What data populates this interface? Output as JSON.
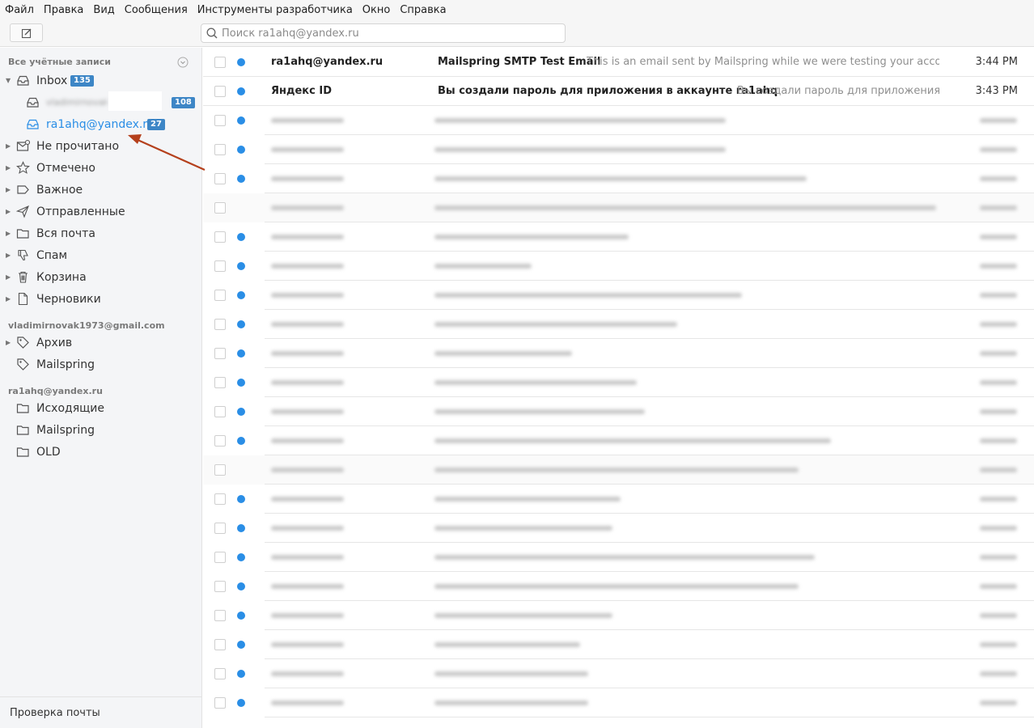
{
  "menubar": [
    "Файл",
    "Правка",
    "Вид",
    "Сообщения",
    "Инструменты разработчика",
    "Окно",
    "Справка"
  ],
  "search": {
    "placeholder": "Поиск ra1ahq@yandex.ru"
  },
  "sidebar": {
    "all_accounts_heading": "Все учётные записи",
    "inbox": {
      "label": "Inbox",
      "badge": "135"
    },
    "account1_inbox": {
      "label": "vladimirnovak1973@gmail.com",
      "badge": "108"
    },
    "account2_inbox": {
      "label": "ra1ahq@yandex.ru",
      "badge": "27"
    },
    "folders": [
      "Не прочитано",
      "Отмечено",
      "Важное",
      "Отправленные",
      "Вся почта",
      "Спам",
      "Корзина",
      "Черновики"
    ],
    "gmail_heading": "vladimirnovak1973@gmail.com",
    "gmail_folders": [
      "Архив",
      "Mailspring"
    ],
    "yandex_heading": "ra1ahq@yandex.ru",
    "yandex_folders": [
      "Исходящие",
      "Mailspring",
      "OLD"
    ],
    "footer": "Проверка почты"
  },
  "messages": [
    {
      "from": "ra1ahq@yandex.ru",
      "subject": "Mailspring SMTP Test Email",
      "snippet": "This is an email sent by Mailspring while we were testing your account con...",
      "time": "3:44 PM"
    },
    {
      "from": "Яндекс ID",
      "subject": "Вы создали пароль для приложения в аккаунте ra1ahq",
      "snippet": "Вы создали пароль для приложения в а...",
      "time": "3:43 PM"
    }
  ],
  "colors": {
    "accent": "#2a8ee6",
    "badge": "#3d86c6",
    "arrow": "#b5401c"
  }
}
